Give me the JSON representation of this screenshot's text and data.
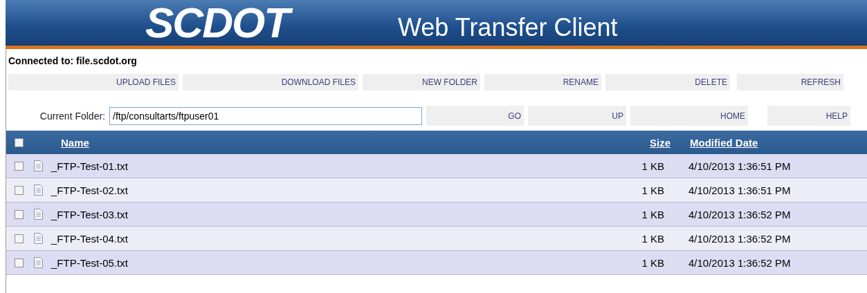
{
  "banner": {
    "logo": "SCDOT",
    "title": "Web Transfer Client"
  },
  "connection": {
    "label": "Connected to: file.scdot.org"
  },
  "actions": [
    "UPLOAD FILES",
    "DOWNLOAD FILES",
    "NEW FOLDER",
    "RENAME",
    "DELETE",
    "REFRESH"
  ],
  "folder": {
    "label": "Current Folder:",
    "value": "/ftp/consultarts/ftpuser01"
  },
  "nav": [
    "GO",
    "UP",
    "HOME",
    "HELP"
  ],
  "table": {
    "select_all_checked": false,
    "columns": [
      "Name",
      "Size",
      "Modified Date"
    ],
    "rows": [
      {
        "name": "_FTP-Test-01.txt",
        "size": "1 KB",
        "modified": "4/10/2013 1:36:51 PM",
        "checked": false
      },
      {
        "name": "_FTP-Test-02.txt",
        "size": "1 KB",
        "modified": "4/10/2013 1:36:51 PM",
        "checked": false
      },
      {
        "name": "_FTP-Test-03.txt",
        "size": "1 KB",
        "modified": "4/10/2013 1:36:52 PM",
        "checked": false
      },
      {
        "name": "_FTP-Test-04.txt",
        "size": "1 KB",
        "modified": "4/10/2013 1:36:52 PM",
        "checked": false
      },
      {
        "name": "_FTP-Test-05.txt",
        "size": "1 KB",
        "modified": "4/10/2013 1:36:52 PM",
        "checked": false
      }
    ]
  }
}
